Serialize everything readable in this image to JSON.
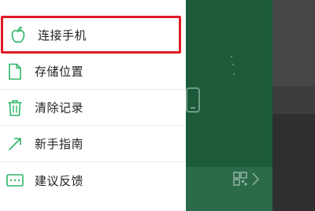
{
  "menu": {
    "items": [
      {
        "label": "连接手机",
        "icon": "apple-icon",
        "selected": true
      },
      {
        "label": "存储位置",
        "icon": "file-icon",
        "selected": false
      },
      {
        "label": "清除记录",
        "icon": "trash-icon",
        "selected": false
      },
      {
        "label": "新手指南",
        "icon": "arrow-up-right-icon",
        "selected": false
      },
      {
        "label": "建议反馈",
        "icon": "message-icon",
        "selected": false
      }
    ]
  },
  "colors": {
    "accent": "#2db566",
    "highlight": "#e01b24",
    "background_green": "#1c5a3a"
  }
}
